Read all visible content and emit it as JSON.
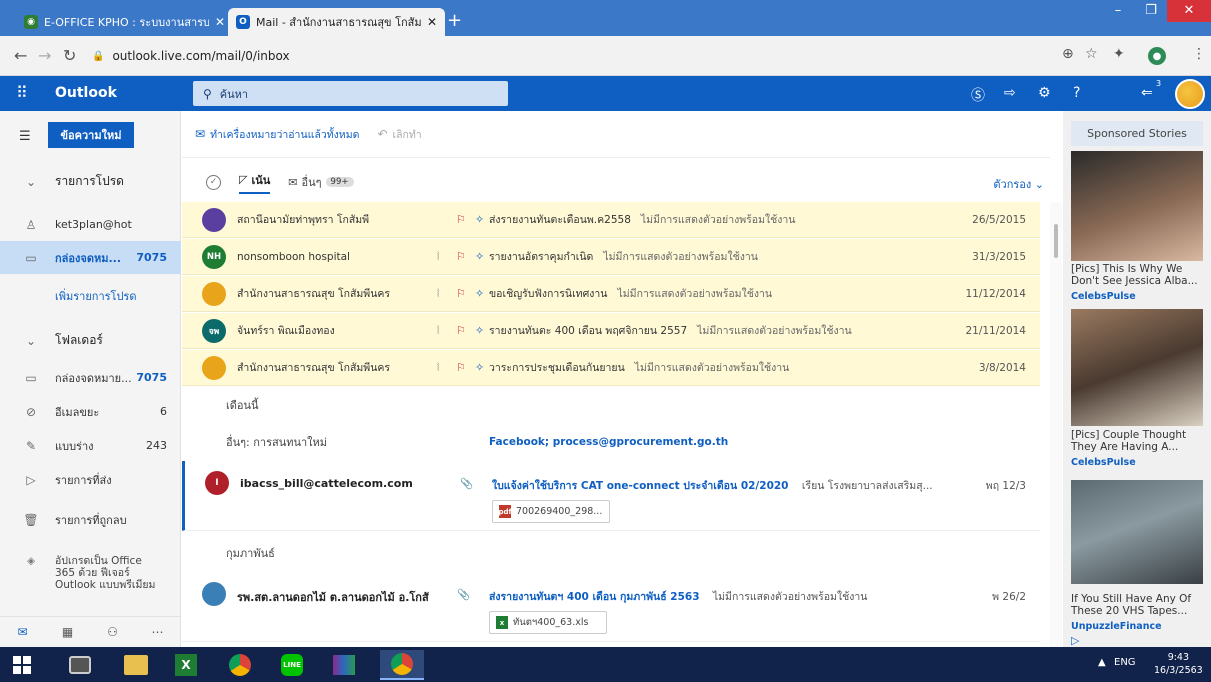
{
  "browser": {
    "tabs": [
      {
        "title": "E-OFFICE KPHO : ระบบงานสารบรรณ",
        "active": false
      },
      {
        "title": "Mail - สำนักงานสาธารณสุข โกสัมพีน",
        "active": true
      }
    ],
    "url": "outlook.live.com/mail/0/inbox"
  },
  "header": {
    "brand": "Outlook",
    "search_placeholder": "ค้นหา",
    "notification_count": "3"
  },
  "sidebar": {
    "new_message": "ข้อความใหม่",
    "favorites_label": "รายการโปรด",
    "account": "ket3plan@hot",
    "fav_inbox_label": "กล่องจดหม...",
    "fav_inbox_count": "7075",
    "add_favorite": "เพิ่มรายการโปรด",
    "folders_label": "โฟลเดอร์",
    "folders": [
      {
        "label": "กล่องจดหมาย...",
        "count": "7075",
        "icon": "inbox-icon"
      },
      {
        "label": "อีเมลขยะ",
        "count": "6",
        "icon": "junk-icon"
      },
      {
        "label": "แบบร่าง",
        "count": "243",
        "icon": "draft-icon"
      },
      {
        "label": "รายการที่ส่ง",
        "count": "",
        "icon": "sent-icon"
      },
      {
        "label": "รายการที่ถูกลบ",
        "count": "",
        "icon": "trash-icon"
      }
    ],
    "upgrade_text": "อัปเกรดเป็น Office 365 ด้วย ฟีเจอร์ Outlook แบบพรีเมียม"
  },
  "commands": {
    "mark_all_read": "ทำเครื่องหมายว่าอ่านแล้วทั้งหมด",
    "undo": "เลิกทำ"
  },
  "filters": {
    "focused": "เน้น",
    "other": "อื่นๆ",
    "other_badge": "99+",
    "filter": "ตัวกรอง"
  },
  "pinned": [
    {
      "sender": "สถานีอนามัยท่าพุทรา โกสัมพี",
      "subject": "ส่งรายงานทันตะเดือนพ.ค2558",
      "preview": "ไม่มีการแสดงตัวอย่างพร้อมใช้งาน",
      "date": "26/5/2015",
      "attach": false,
      "avatar": "",
      "color": "#5b3fa0"
    },
    {
      "sender": "nonsomboon hospital",
      "subject": "รายงานอัตราคุมกำเนิด",
      "preview": "ไม่มีการแสดงตัวอย่างพร้อมใช้งาน",
      "date": "31/3/2015",
      "attach": true,
      "avatar": "NH",
      "color": "#1e7d32"
    },
    {
      "sender": "สำนักงานสาธารณสุข โกสัมพีนคร",
      "subject": "ขอเชิญรับฟังการนิเทศงาน",
      "preview": "ไม่มีการแสดงตัวอย่างพร้อมใช้งาน",
      "date": "11/12/2014",
      "attach": true,
      "avatar": "",
      "color": "#e8a51c"
    },
    {
      "sender": "จันทร์รา พิณเมืองทอง",
      "subject": "รายงานทันตะ 400 เดือน พฤศจิกายน 2557",
      "preview": "ไม่มีการแสดงตัวอย่างพร้อมใช้งาน",
      "date": "21/11/2014",
      "attach": true,
      "avatar": "จพ",
      "color": "#0b6b6b"
    },
    {
      "sender": "สำนักงานสาธารณสุข โกสัมพีนคร",
      "subject": "วาระการประชุมเดือนกันยายน",
      "preview": "ไม่มีการแสดงตัวอย่างพร้อมใช้งาน",
      "date": "3/8/2014",
      "attach": true,
      "avatar": "",
      "color": "#e8a51c"
    }
  ],
  "groups": {
    "this_month": "เดือนนี้",
    "other_new": "อื่นๆ: การสนทนาใหม่",
    "other_new_value": "Facebook; process@gprocurement.go.th",
    "february": "กุมภาพันธ์"
  },
  "messages": [
    {
      "sender": "ibacss_bill@cattelecom.com",
      "subject": "ใบแจ้งค่าใช้บริการ CAT one-connect ประจำเดือน 02/2020",
      "preview": "เรียน โรงพยาบาลส่งเสริมสุ...",
      "date": "พฤ 12/3",
      "attachment": "700269400_298...",
      "avatar": "I",
      "color": "#b0202a",
      "file_label": "pdf",
      "file_color": "#c0392b"
    },
    {
      "sender": "รพ.สต.ลานดอกไม้ ต.ลานดอกไม้ อ.โกสั",
      "subject": "ส่งรายงานทันตฯ 400 เดือน กุมภาพันธ์ 2563",
      "preview": "ไม่มีการแสดงตัวอย่างพร้อมใช้งาน",
      "date": "พ 26/2",
      "attachment": "ทันตฯ400_63.xls",
      "avatar": "",
      "color": "#3a7fb5",
      "file_label": "x",
      "file_color": "#1e7d32"
    }
  ],
  "ads": {
    "title": "Sponsored Stories",
    "items": [
      {
        "text": "[Pics] This Is Why We Don't See Jessica Alba...",
        "source": "CelebsPulse"
      },
      {
        "text": "[Pics] Couple Thought They Are Having A...",
        "source": "CelebsPulse"
      },
      {
        "text": "If You Still Have Any Of These 20 VHS Tapes...",
        "source": "UnpuzzleFinance"
      }
    ]
  },
  "taskbar": {
    "lang": "ENG",
    "time": "9:43",
    "date": "16/3/2563"
  }
}
